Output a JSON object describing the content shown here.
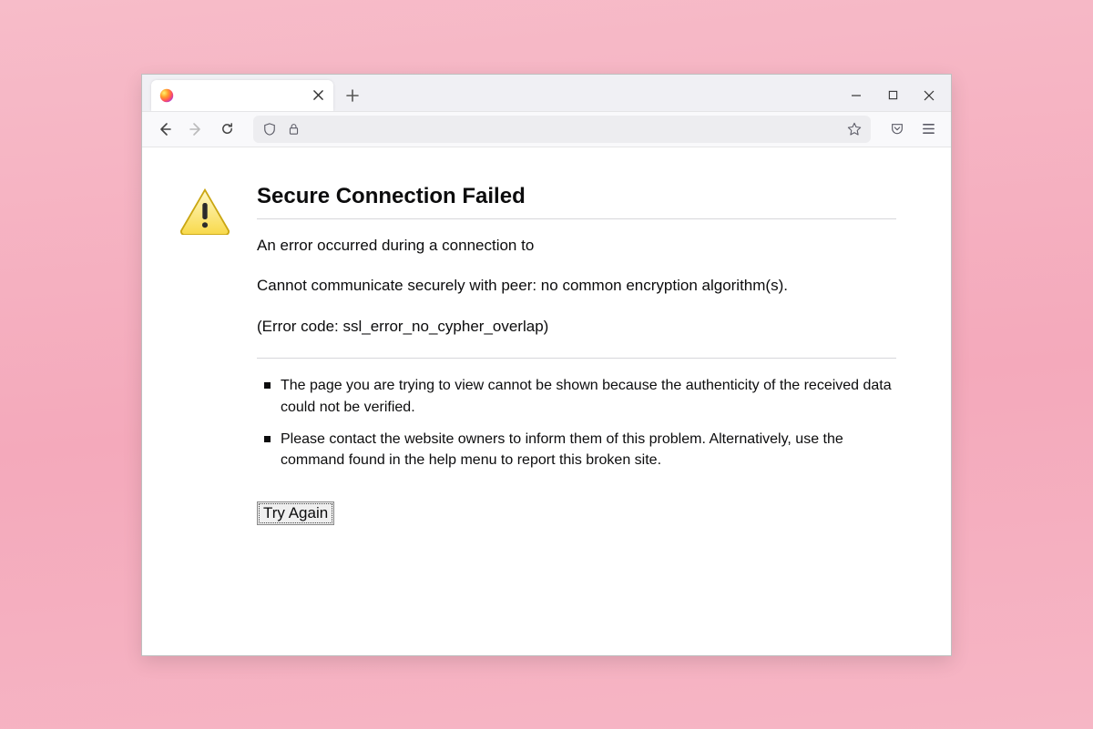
{
  "tab": {
    "title": ""
  },
  "error": {
    "heading": "Secure Connection Failed",
    "line1": "An error occurred during a connection to",
    "line2": "Cannot communicate securely with peer: no common encryption algorithm(s).",
    "line3": "(Error code: ssl_error_no_cypher_overlap)",
    "bullets": [
      "The page you are trying to view cannot be shown because the authenticity of the received data could not be verified.",
      "Please contact the website owners to inform them of this problem. Alternatively, use the command found in the help menu to report this broken site."
    ],
    "try_again_label": "Try Again"
  }
}
